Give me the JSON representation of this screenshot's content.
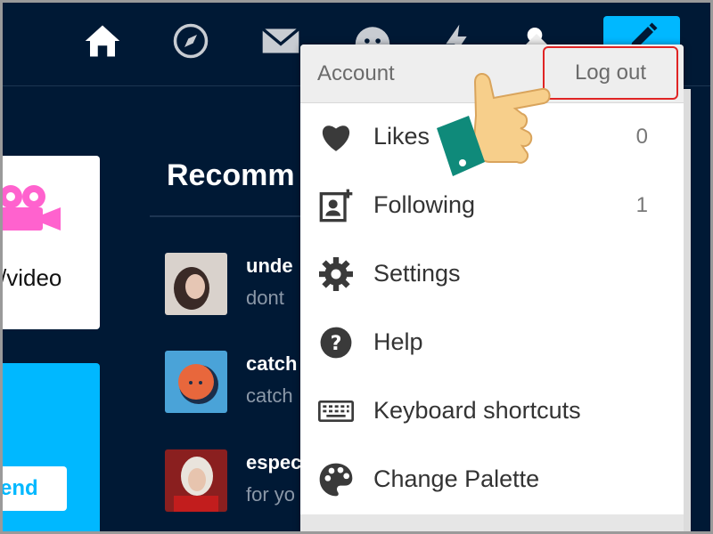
{
  "recommended": {
    "title": "Recomm",
    "items": [
      {
        "name": "unde",
        "subtitle": "dont"
      },
      {
        "name": "catch",
        "subtitle": "catch"
      },
      {
        "name": "espec",
        "subtitle": "for yo"
      }
    ]
  },
  "left_cards": {
    "video_label": "/video",
    "blue_button_label": "end"
  },
  "menu": {
    "header_label": "Account",
    "logout_label": "Log out",
    "items": [
      {
        "label": "Likes",
        "count": "0",
        "icon": "heart-icon"
      },
      {
        "label": "Following",
        "count": "1",
        "icon": "following-icon"
      },
      {
        "label": "Settings",
        "count": "",
        "icon": "gear-icon"
      },
      {
        "label": "Help",
        "count": "",
        "icon": "help-icon"
      },
      {
        "label": "Keyboard shortcuts",
        "count": "",
        "icon": "keyboard-icon"
      },
      {
        "label": "Change Palette",
        "count": "",
        "icon": "palette-icon"
      }
    ]
  },
  "colors": {
    "background": "#001935",
    "accent": "#00b8ff",
    "video_icon": "#ff62ce",
    "highlight": "#e02424"
  },
  "nav_icons": [
    "home-icon",
    "explore-icon",
    "mail-icon",
    "chat-icon",
    "activity-icon",
    "account-icon",
    "compose-icon"
  ]
}
